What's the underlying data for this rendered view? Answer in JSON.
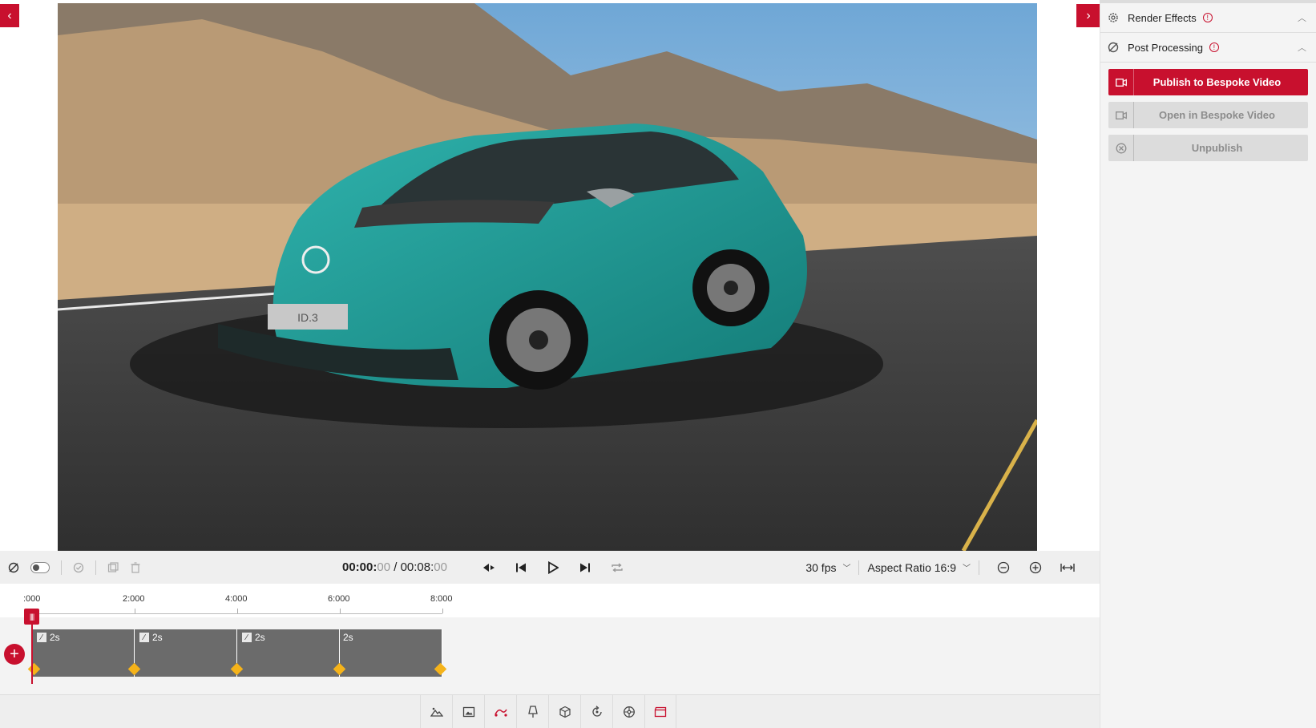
{
  "panel": {
    "render_effects": "Render Effects",
    "post_processing": "Post Processing",
    "publish_button": "Publish to Bespoke Video",
    "open_button": "Open in Bespoke Video",
    "unpublish_button": "Unpublish"
  },
  "transport": {
    "time_current_main": "00:00:",
    "time_current_frames": "00",
    "time_separator": " / ",
    "time_total_main": "00:08:",
    "time_total_frames": "00",
    "fps": "30 fps",
    "aspect_ratio": "Aspect Ratio 16:9"
  },
  "ruler": {
    "labels": [
      ":000",
      "2:000",
      "4:000",
      "6:000",
      "8:000"
    ]
  },
  "clips": [
    {
      "label": "2s"
    },
    {
      "label": "2s"
    },
    {
      "label": "2s"
    },
    {
      "label": "2s"
    }
  ],
  "scene": {
    "plate_text": "ID.3"
  },
  "colors": {
    "accent": "#c8102e",
    "keyframe": "#f5b31a",
    "clip": "#6b6b6b"
  }
}
